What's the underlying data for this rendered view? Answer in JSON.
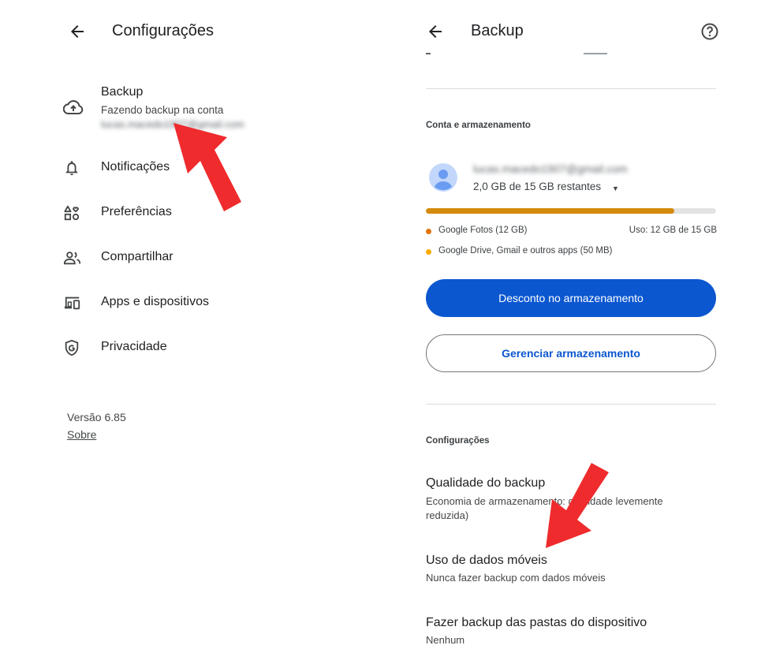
{
  "left": {
    "title": "Configurações",
    "backup": {
      "title": "Backup",
      "subtitle": "Fazendo backup na conta",
      "email": "lucas.macedo1907@gmail.com"
    },
    "menu": [
      {
        "label": "Notificações",
        "icon": "bell-icon"
      },
      {
        "label": "Preferências",
        "icon": "shapes-icon"
      },
      {
        "label": "Compartilhar",
        "icon": "people-icon"
      },
      {
        "label": "Apps e dispositivos",
        "icon": "devices-icon"
      },
      {
        "label": "Privacidade",
        "icon": "shield-icon"
      }
    ],
    "version": "Versão 6.85",
    "about_link": "Sobre"
  },
  "right": {
    "title": "Backup",
    "storage_section": {
      "label": "Conta e armazenamento",
      "email": "lucas.macedo1907@gmail.com",
      "remaining": "2,0 GB de 15 GB restantes",
      "usage_fraction": 0.857,
      "legend": [
        {
          "label": "Google Fotos (12 GB)",
          "color": "#e37400"
        },
        {
          "label": "Google Drive, Gmail e outros apps (50 MB)",
          "color": "#f9ab00"
        }
      ],
      "usage_text": "Uso: 12 GB de 15 GB",
      "primary_button": "Desconto no armazenamento",
      "secondary_button": "Gerenciar armazenamento"
    },
    "settings_section": {
      "label": "Configurações",
      "items": [
        {
          "title": "Qualidade do backup",
          "subtitle": "Economia de armazenamento: qualidade levemente reduzida)"
        },
        {
          "title": "Uso de dados móveis",
          "subtitle": "Nunca fazer backup com dados móveis"
        },
        {
          "title": "Fazer backup das pastas do dispositivo",
          "subtitle": "Nenhum"
        }
      ]
    }
  },
  "colors": {
    "accent": "#0b57d0",
    "arrow": "#ef2b2d",
    "bar_fill": "#d48a0c",
    "bar_track": "#e3e3e3"
  }
}
